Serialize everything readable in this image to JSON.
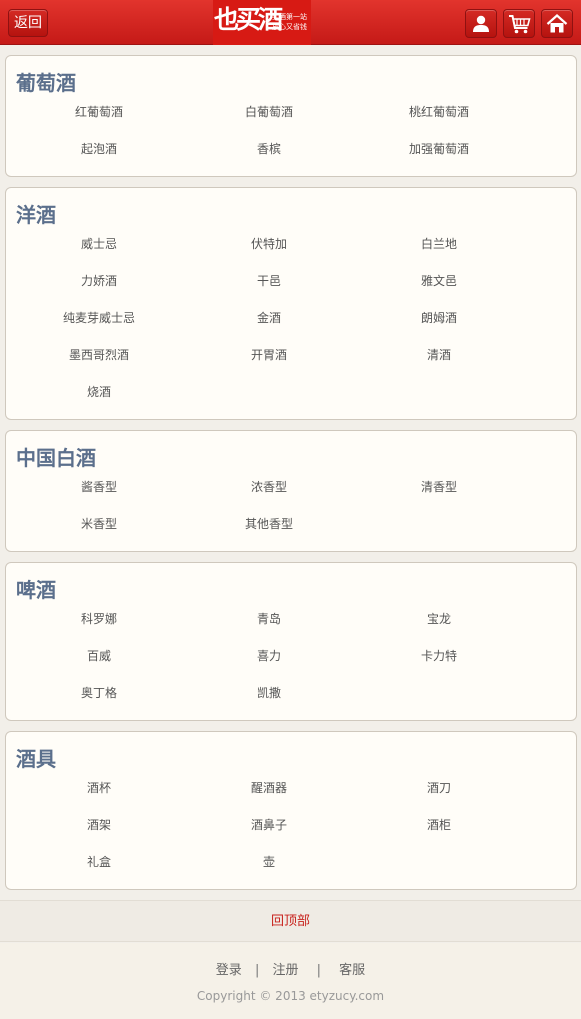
{
  "header": {
    "back_label": "返回",
    "logo": {
      "main": "也买酒",
      "slogan_line1": "买酒第一站",
      "slogan_line2": "放心又省钱"
    },
    "icons": [
      "user-icon",
      "cart-icon",
      "home-icon"
    ]
  },
  "categories": [
    {
      "title": "葡萄酒",
      "items": [
        "红葡萄酒",
        "白葡萄酒",
        "桃红葡萄酒",
        "起泡酒",
        "香槟",
        "加强葡萄酒"
      ]
    },
    {
      "title": "洋酒",
      "items": [
        "威士忌",
        "伏特加",
        "白兰地",
        "力娇酒",
        "干邑",
        "雅文邑",
        "纯麦芽威士忌",
        "金酒",
        "朗姆酒",
        "墨西哥烈酒",
        "开胃酒",
        "清酒",
        "烧酒"
      ]
    },
    {
      "title": "中国白酒",
      "items": [
        "酱香型",
        "浓香型",
        "清香型",
        "米香型",
        "其他香型"
      ]
    },
    {
      "title": "啤酒",
      "items": [
        "科罗娜",
        "青岛",
        "宝龙",
        "百威",
        "喜力",
        "卡力特",
        "奥丁格",
        "凯撒"
      ]
    },
    {
      "title": "酒具",
      "items": [
        "酒杯",
        "醒酒器",
        "酒刀",
        "酒架",
        "酒鼻子",
        "酒柜",
        "礼盒",
        "壶"
      ]
    }
  ],
  "footer": {
    "back_to_top": "回顶部",
    "login": "登录",
    "register": "注册",
    "service": "客服",
    "separator": "|",
    "copyright": "Copyright © 2013 etyzucy.com"
  },
  "colors": {
    "header_red": "#d42a24",
    "category_title": "#5b6f8c",
    "link_red": "#c8221c"
  }
}
